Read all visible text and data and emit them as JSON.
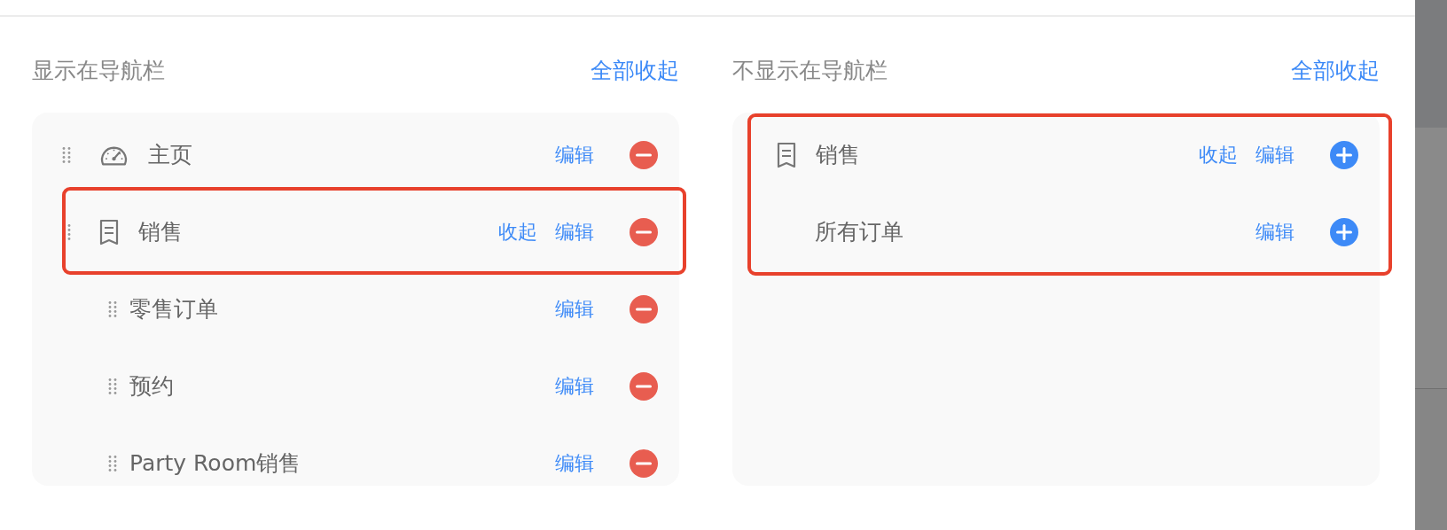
{
  "panels": [
    {
      "title": "显示在导航栏",
      "collapse_all": "全部收起",
      "draggable": true,
      "items": [
        {
          "kind": "page",
          "label": "主页",
          "edit": "编辑",
          "removable": true,
          "highlighted": false
        },
        {
          "kind": "group",
          "label": "销售",
          "collapse": "收起",
          "edit": "编辑",
          "removable": true,
          "highlighted": true,
          "children": [
            {
              "label": "零售订单",
              "edit": "编辑",
              "removable": true,
              "highlighted": false
            },
            {
              "label": "预约",
              "edit": "编辑",
              "removable": true,
              "highlighted": false
            },
            {
              "label": "Party Room销售",
              "edit": "编辑",
              "removable": true,
              "highlighted": false
            }
          ]
        }
      ]
    },
    {
      "title": "不显示在导航栏",
      "collapse_all": "全部收起",
      "draggable": false,
      "items": [
        {
          "kind": "group",
          "label": "销售",
          "collapse": "收起",
          "edit": "编辑",
          "removable": false,
          "highlighted": true,
          "children": [
            {
              "label": "所有订单",
              "edit": "编辑",
              "removable": false,
              "highlighted": true
            }
          ]
        }
      ]
    }
  ]
}
